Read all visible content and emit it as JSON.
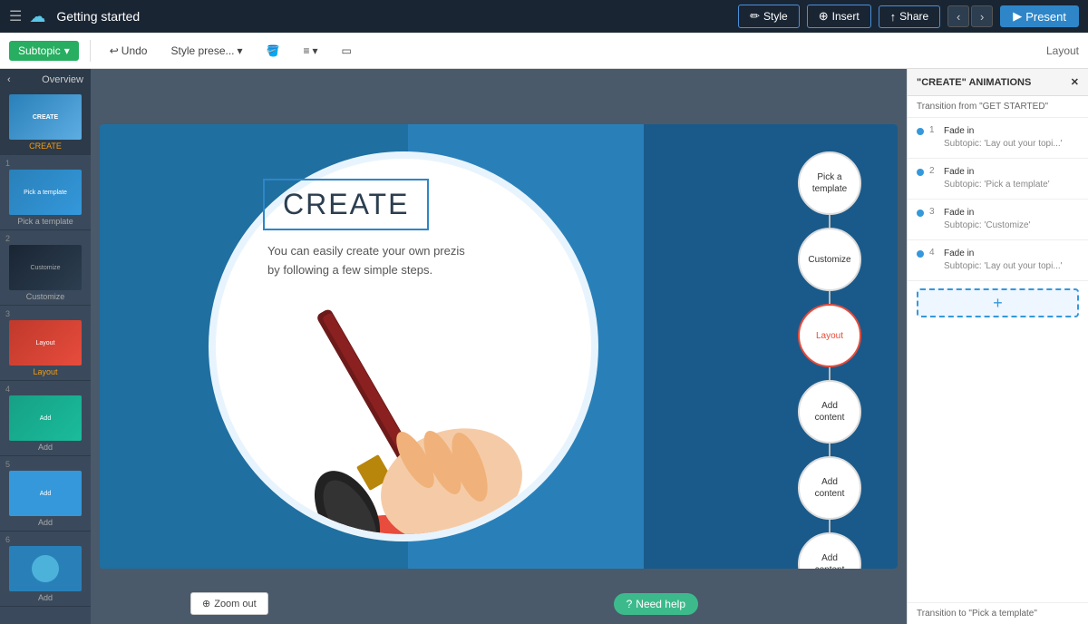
{
  "app": {
    "title": "Getting started",
    "logo_icon": "☁"
  },
  "topnav": {
    "style_btn": "Style",
    "insert_btn": "Insert",
    "share_btn": "Share",
    "present_btn": "Present",
    "style_icon": "✏",
    "insert_icon": "⊕",
    "share_icon": "↑"
  },
  "toolbar": {
    "subtopic_label": "Subtopic",
    "undo_label": "Undo",
    "style_preset_label": "Style prese...",
    "layout_label": "Layout"
  },
  "left_panel": {
    "header": "Overview",
    "slides": [
      {
        "num": "",
        "label": "CREATE",
        "label_class": "highlight",
        "bg": "thumb-create"
      },
      {
        "num": "1",
        "label": "Pick a template",
        "label_class": "",
        "bg": "thumb-bg-blue"
      },
      {
        "num": "2",
        "label": "Customize",
        "label_class": "",
        "bg": "thumb-bg-dark"
      },
      {
        "num": "3",
        "label": "Layout",
        "label_class": "highlight",
        "bg": "thumb-bg-red"
      },
      {
        "num": "4",
        "label": "Add",
        "label_class": "",
        "bg": "thumb-bg-teal"
      },
      {
        "num": "5",
        "label": "Add",
        "label_class": "",
        "bg": "thumb-bg-blue2"
      },
      {
        "num": "6",
        "label": "Add",
        "label_class": "",
        "bg": "thumb-bg-circle"
      }
    ]
  },
  "canvas": {
    "title": "CREATE",
    "body_text": "You can easily create your own prezis by following a few simple steps.",
    "bubbles": [
      {
        "label": "Pick a\ntemplate",
        "active": false
      },
      {
        "label": "Customize",
        "active": false
      },
      {
        "label": "Layout",
        "active": true
      },
      {
        "label": "Add\ncontent",
        "active": false
      },
      {
        "label": "Add\ncontent",
        "active": false
      },
      {
        "label": "Add\ncontent",
        "active": false
      }
    ]
  },
  "bottom": {
    "zoom_out": "Zoom out",
    "need_help": "Need help"
  },
  "right_panel": {
    "header": "\"CREATE\" ANIMATIONS",
    "subtitle": "Transition from \"GET STARTED\"",
    "animations": [
      {
        "num": "1",
        "type": "Fade in",
        "detail": "Subtopic: 'Lay out your topi...'"
      },
      {
        "num": "2",
        "type": "Fade in",
        "detail": "Subtopic: 'Pick a template'"
      },
      {
        "num": "3",
        "type": "Fade in",
        "detail": "Subtopic: 'Customize'"
      },
      {
        "num": "4",
        "type": "Fade in",
        "detail": "Subtopic: 'Lay out your topi...'"
      }
    ],
    "add_icon": "+",
    "footer": "Transition to \"Pick a template\""
  }
}
